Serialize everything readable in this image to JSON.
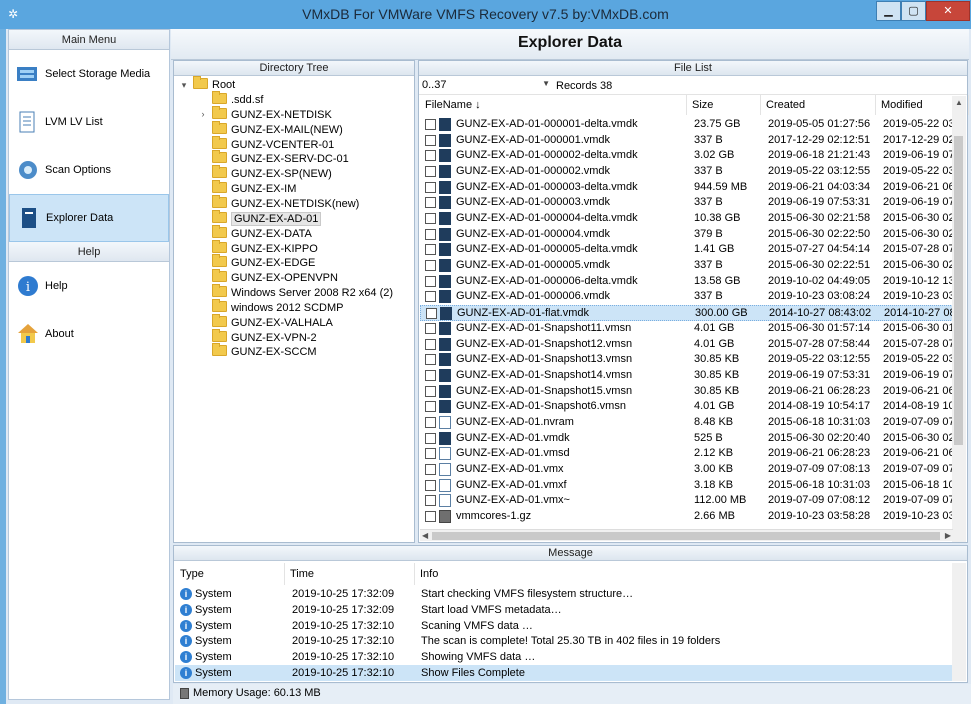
{
  "window": {
    "title": "VMxDB For VMWare VMFS Recovery v7.5 by:VMxDB.com"
  },
  "nav": {
    "main_header": "Main Menu",
    "help_header": "Help",
    "items": [
      {
        "label": "Select Storage Media",
        "icon": "storage-media-icon"
      },
      {
        "label": "LVM LV List",
        "icon": "lv-list-icon"
      },
      {
        "label": "Scan Options",
        "icon": "gear-icon"
      },
      {
        "label": "Explorer Data",
        "icon": "document-icon"
      }
    ],
    "help_items": [
      {
        "label": "Help",
        "icon": "info-icon"
      },
      {
        "label": "About",
        "icon": "home-icon"
      }
    ]
  },
  "explorer": {
    "title": "Explorer Data"
  },
  "tree": {
    "header": "Directory Tree",
    "root": "Root",
    "items": [
      ".sdd.sf",
      "GUNZ-EX-NETDISK",
      "GUNZ-EX-MAIL(NEW)",
      "GUNZ-VCENTER-01",
      "GUNZ-EX-SERV-DC-01",
      "GUNZ-EX-SP(NEW)",
      "GUNZ-EX-IM",
      "GUNZ-EX-NETDISK(new)",
      "GUNZ-EX-AD-01",
      "GUNZ-EX-DATA",
      "GUNZ-EX-KIPPO",
      "GUNZ-EX-EDGE",
      "GUNZ-EX-OPENVPN",
      "Windows Server 2008 R2 x64 (2)",
      "windows 2012 SCDMP",
      "GUNZ-EX-VALHALA",
      "GUNZ-EX-VPN-2",
      "GUNZ-EX-SCCM"
    ],
    "selected": "GUNZ-EX-AD-01"
  },
  "files": {
    "header": "File List",
    "pager": "0..37",
    "records": "Records 38",
    "columns": [
      "FileName ↓",
      "Size",
      "Created",
      "Modified"
    ],
    "rows": [
      [
        "GUNZ-EX-AD-01-000001-delta.vmdk",
        "23.75 GB",
        "2019-05-05 01:27:56",
        "2019-05-22 03:"
      ],
      [
        "GUNZ-EX-AD-01-000001.vmdk",
        "337 B",
        "2017-12-29 02:12:51",
        "2017-12-29 02:"
      ],
      [
        "GUNZ-EX-AD-01-000002-delta.vmdk",
        "3.02 GB",
        "2019-06-18 21:21:43",
        "2019-06-19 07:"
      ],
      [
        "GUNZ-EX-AD-01-000002.vmdk",
        "337 B",
        "2019-05-22 03:12:55",
        "2019-05-22 03:"
      ],
      [
        "GUNZ-EX-AD-01-000003-delta.vmdk",
        "944.59 MB",
        "2019-06-21 04:03:34",
        "2019-06-21 06:"
      ],
      [
        "GUNZ-EX-AD-01-000003.vmdk",
        "337 B",
        "2019-06-19 07:53:31",
        "2019-06-19 07:"
      ],
      [
        "GUNZ-EX-AD-01-000004-delta.vmdk",
        "10.38 GB",
        "2015-06-30 02:21:58",
        "2015-06-30 02:"
      ],
      [
        "GUNZ-EX-AD-01-000004.vmdk",
        "379 B",
        "2015-06-30 02:22:50",
        "2015-06-30 02:"
      ],
      [
        "GUNZ-EX-AD-01-000005-delta.vmdk",
        "1.41 GB",
        "2015-07-27 04:54:14",
        "2015-07-28 07:"
      ],
      [
        "GUNZ-EX-AD-01-000005.vmdk",
        "337 B",
        "2015-06-30 02:22:51",
        "2015-06-30 02:"
      ],
      [
        "GUNZ-EX-AD-01-000006-delta.vmdk",
        "13.58 GB",
        "2019-10-02 04:49:05",
        "2019-10-12 13:"
      ],
      [
        "GUNZ-EX-AD-01-000006.vmdk",
        "337 B",
        "2019-10-23 03:08:24",
        "2019-10-23 03:"
      ],
      [
        "GUNZ-EX-AD-01-flat.vmdk",
        "300.00 GB",
        "2014-10-27 08:43:02",
        "2014-10-27 08:"
      ],
      [
        "GUNZ-EX-AD-01-Snapshot11.vmsn",
        "4.01 GB",
        "2015-06-30 01:57:14",
        "2015-06-30 01:"
      ],
      [
        "GUNZ-EX-AD-01-Snapshot12.vmsn",
        "4.01 GB",
        "2015-07-28 07:58:44",
        "2015-07-28 07:"
      ],
      [
        "GUNZ-EX-AD-01-Snapshot13.vmsn",
        "30.85 KB",
        "2019-05-22 03:12:55",
        "2019-05-22 03:"
      ],
      [
        "GUNZ-EX-AD-01-Snapshot14.vmsn",
        "30.85 KB",
        "2019-06-19 07:53:31",
        "2019-06-19 07:"
      ],
      [
        "GUNZ-EX-AD-01-Snapshot15.vmsn",
        "30.85 KB",
        "2019-06-21 06:28:23",
        "2019-06-21 06:"
      ],
      [
        "GUNZ-EX-AD-01-Snapshot6.vmsn",
        "4.01 GB",
        "2014-08-19 10:54:17",
        "2014-08-19 10:"
      ],
      [
        "GUNZ-EX-AD-01.nvram",
        "8.48 KB",
        "2015-06-18 10:31:03",
        "2019-07-09 07:"
      ],
      [
        "GUNZ-EX-AD-01.vmdk",
        "525 B",
        "2015-06-30 02:20:40",
        "2015-06-30 02:"
      ],
      [
        "GUNZ-EX-AD-01.vmsd",
        "2.12 KB",
        "2019-06-21 06:28:23",
        "2019-06-21 06:"
      ],
      [
        "GUNZ-EX-AD-01.vmx",
        "3.00 KB",
        "2019-07-09 07:08:13",
        "2019-07-09 07:"
      ],
      [
        "GUNZ-EX-AD-01.vmxf",
        "3.18 KB",
        "2015-06-18 10:31:03",
        "2015-06-18 10:"
      ],
      [
        "GUNZ-EX-AD-01.vmx~",
        "112.00 MB",
        "2019-07-09 07:08:12",
        "2019-07-09 07:"
      ],
      [
        "vmmcores-1.gz",
        "2.66 MB",
        "2019-10-23 03:58:28",
        "2019-10-23 03:"
      ]
    ],
    "selected_index": 12
  },
  "messages": {
    "header": "Message",
    "columns": [
      "Type",
      "Time",
      "Info"
    ],
    "rows": [
      [
        "System",
        "2019-10-25 17:32:09",
        "Start checking VMFS filesystem structure…"
      ],
      [
        "System",
        "2019-10-25 17:32:09",
        "Start load VMFS metadata…"
      ],
      [
        "System",
        "2019-10-25 17:32:10",
        "Scaning VMFS data …"
      ],
      [
        "System",
        "2019-10-25 17:32:10",
        "The scan is complete!  Total 25.30 TB  in 402 files in 19 folders"
      ],
      [
        "System",
        "2019-10-25 17:32:10",
        "Showing VMFS data …"
      ],
      [
        "System",
        "2019-10-25 17:32:10",
        "Show Files Complete"
      ]
    ]
  },
  "status": {
    "memory": "Memory Usage: 60.13 MB"
  }
}
